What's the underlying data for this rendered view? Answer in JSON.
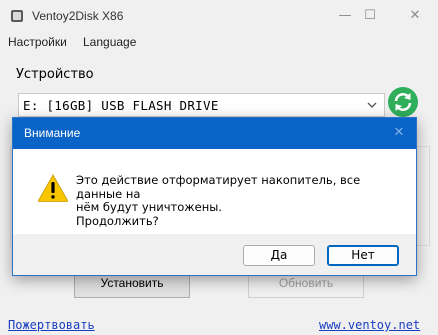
{
  "window": {
    "title": "Ventoy2Disk  X86",
    "minimize_glyph": "—",
    "maximize_glyph": "☐",
    "close_glyph": "✕"
  },
  "menu": {
    "items": [
      {
        "label": "Настройки"
      },
      {
        "label": "Language"
      }
    ]
  },
  "device_group": {
    "label": "Устройство",
    "selected_device": "E: [16GB]  USB FLASH DRIVE",
    "refresh_icon_color": "#2fae5c"
  },
  "actions": {
    "install_label": "Установить",
    "update_label": "Обновить"
  },
  "footer": {
    "donate_label": "Пожертвовать",
    "website_label": "www.ventoy.net"
  },
  "dialog": {
    "title": "Внимание",
    "close_glyph": "✕",
    "icon": "warning-icon",
    "message": "Это действие отформатирует накопитель, все данные на\nнём будут уничтожены.\nПродолжить?",
    "yes_label": "Да",
    "no_label": "Нет",
    "accent_color": "#0a64c8"
  }
}
